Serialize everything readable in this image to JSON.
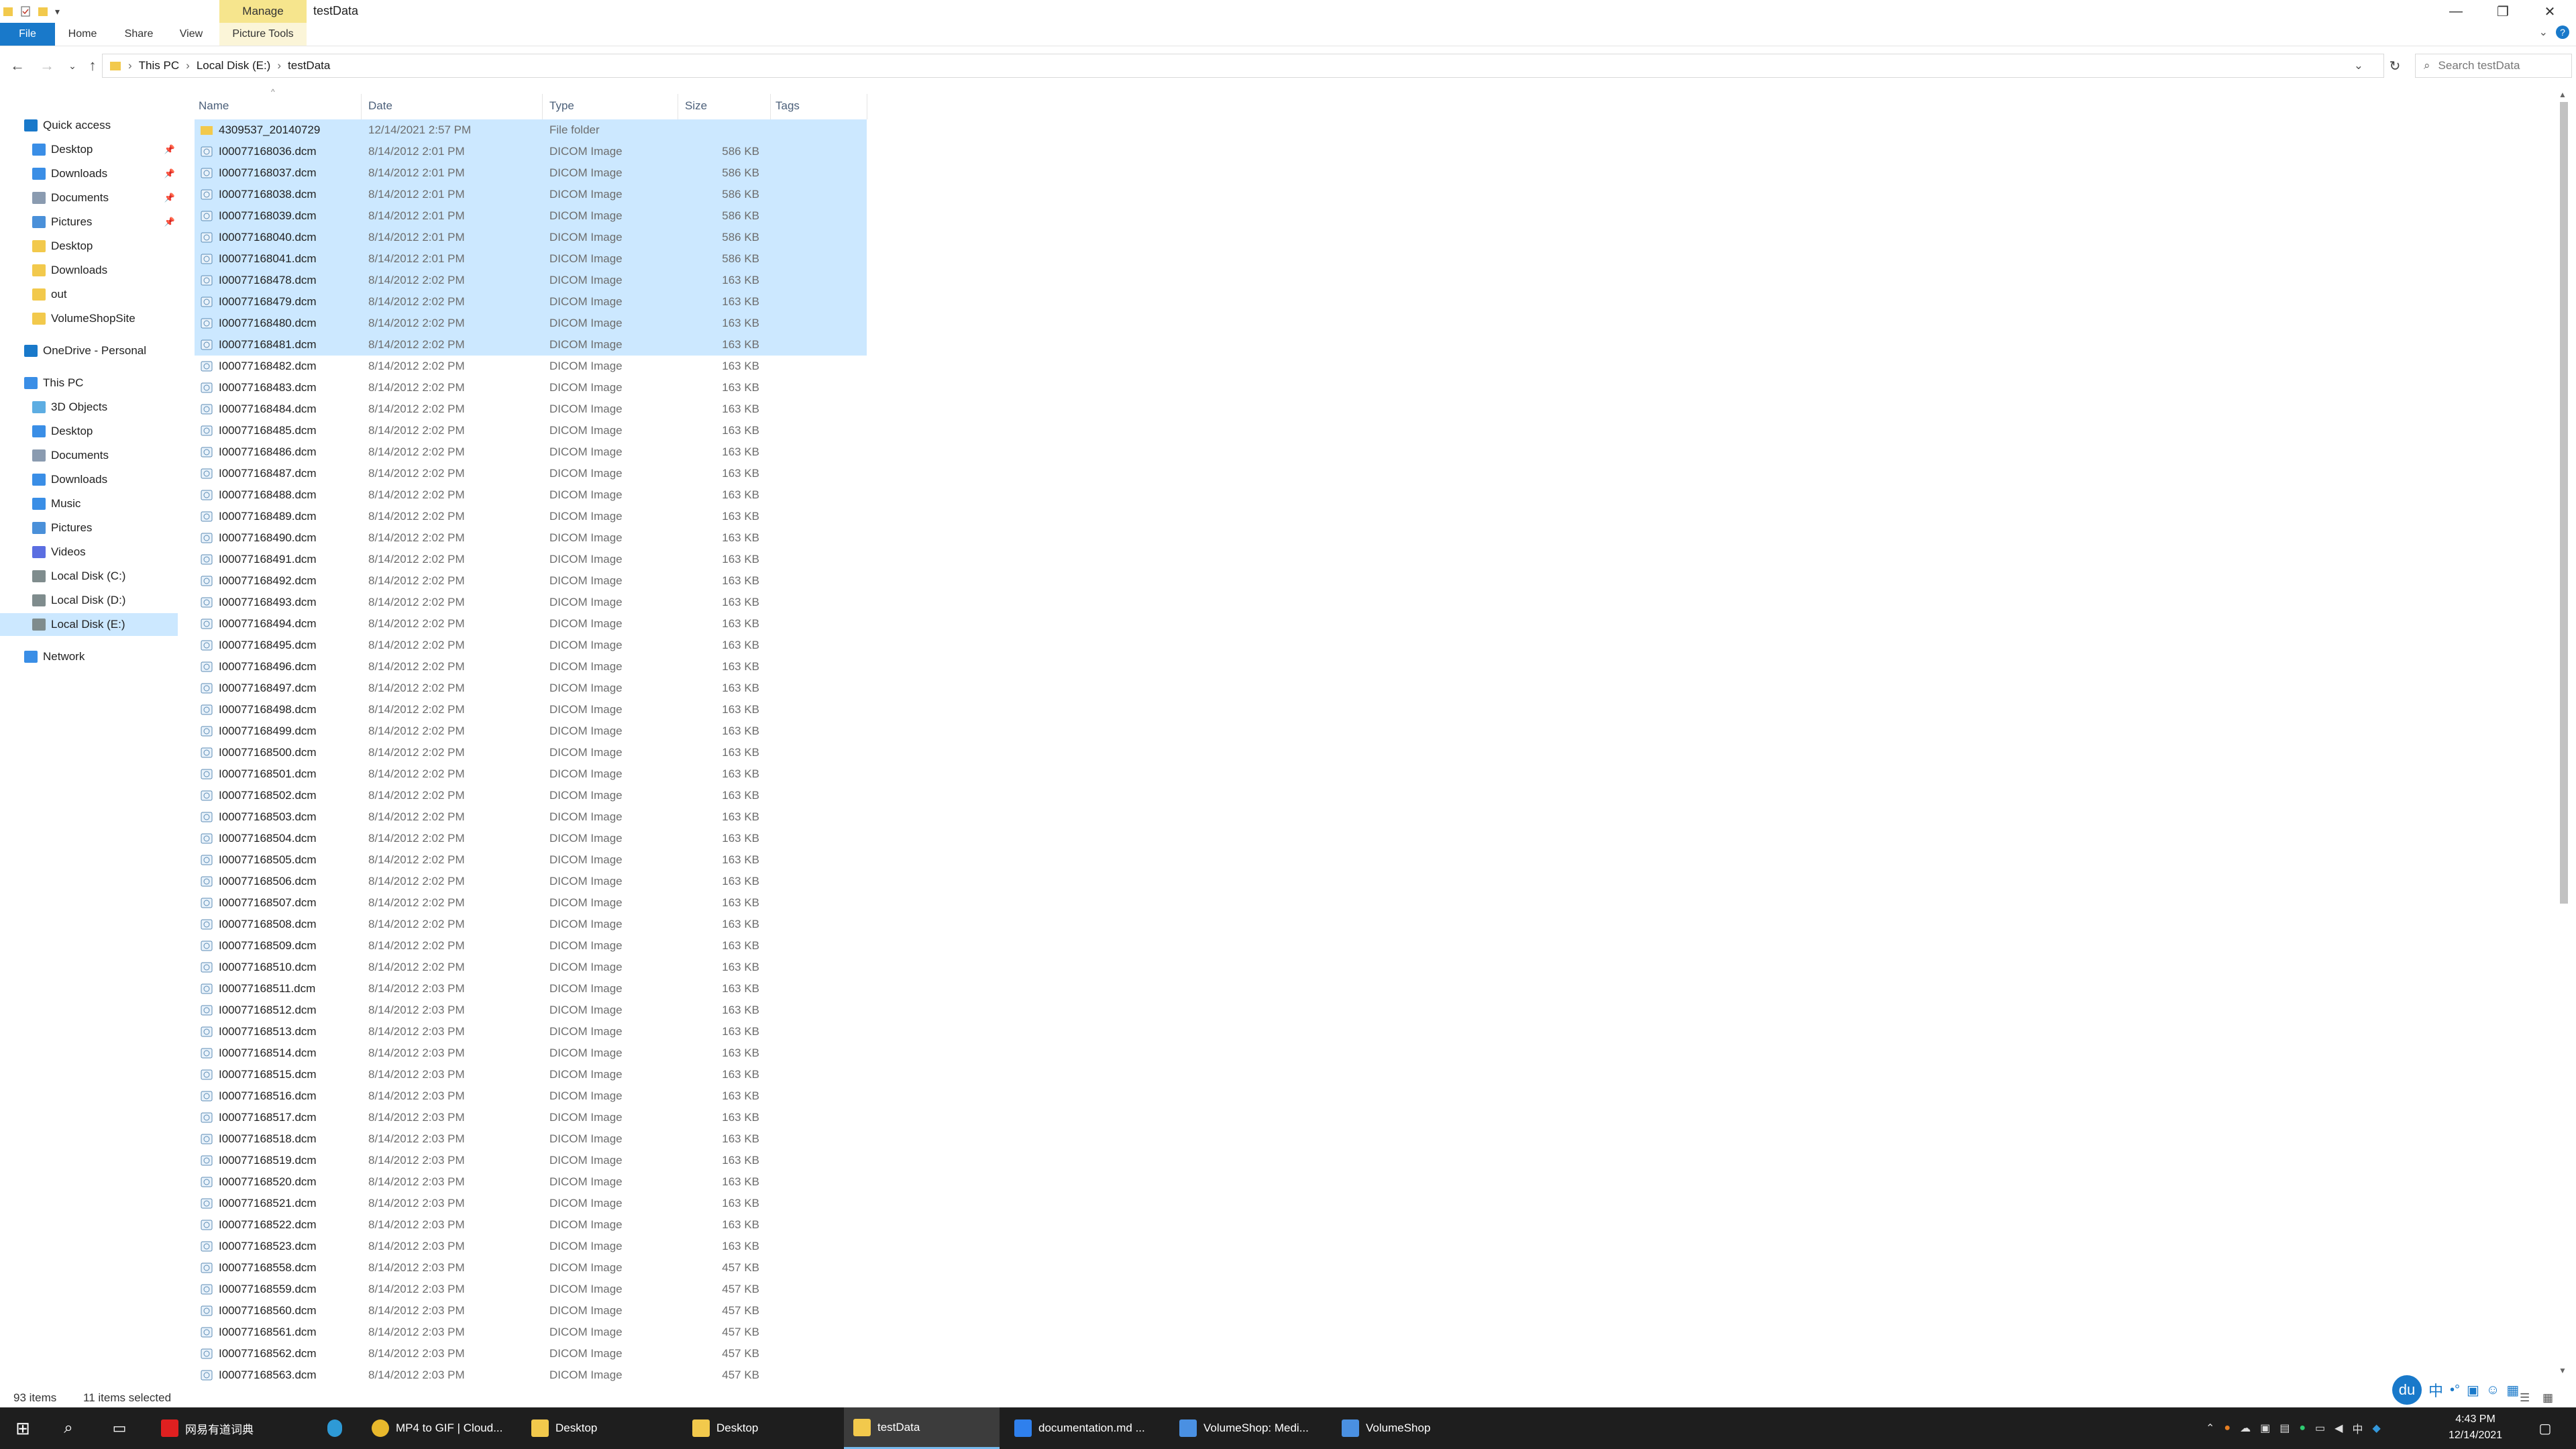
{
  "window": {
    "title": "testData",
    "contextual_tab": "Manage",
    "minimize": "—",
    "maximize": "❐",
    "close": "✕"
  },
  "ribbon": {
    "tabs": [
      "File",
      "Home",
      "Share",
      "View",
      "Picture Tools"
    ],
    "file_color": "#1979ca"
  },
  "address": {
    "crumbs": [
      "This PC",
      "Local Disk (E:)",
      "testData"
    ],
    "search_placeholder": "Search testData"
  },
  "navpane": {
    "items": [
      {
        "label": "Quick access",
        "icon": "star-icon",
        "pinned": false
      },
      {
        "label": "Desktop",
        "icon": "desktop-icon",
        "pinned": true
      },
      {
        "label": "Downloads",
        "icon": "download-icon",
        "pinned": true
      },
      {
        "label": "Documents",
        "icon": "document-icon",
        "pinned": true
      },
      {
        "label": "Pictures",
        "icon": "pictures-icon",
        "pinned": true
      },
      {
        "label": "Desktop",
        "icon": "folder-icon",
        "pinned": false
      },
      {
        "label": "Downloads",
        "icon": "folder-icon",
        "pinned": false
      },
      {
        "label": "out",
        "icon": "folder-icon",
        "pinned": false
      },
      {
        "label": "VolumeShopSite",
        "icon": "folder-icon",
        "pinned": false
      },
      {
        "label": "OneDrive - Personal",
        "icon": "cloud-icon",
        "pinned": false
      },
      {
        "label": "This PC",
        "icon": "computer-icon",
        "pinned": false
      },
      {
        "label": "3D Objects",
        "icon": "cube-icon",
        "pinned": false
      },
      {
        "label": "Desktop",
        "icon": "desktop-icon",
        "pinned": false
      },
      {
        "label": "Documents",
        "icon": "document-icon",
        "pinned": false
      },
      {
        "label": "Downloads",
        "icon": "download-icon",
        "pinned": false
      },
      {
        "label": "Music",
        "icon": "music-icon",
        "pinned": false
      },
      {
        "label": "Pictures",
        "icon": "pictures-icon",
        "pinned": false
      },
      {
        "label": "Videos",
        "icon": "video-icon",
        "pinned": false
      },
      {
        "label": "Local Disk (C:)",
        "icon": "drive-icon",
        "pinned": false
      },
      {
        "label": "Local Disk (D:)",
        "icon": "drive-icon",
        "pinned": false
      },
      {
        "label": "Local Disk (E:)",
        "icon": "drive-icon",
        "pinned": false
      },
      {
        "label": "Network",
        "icon": "network-icon",
        "pinned": false
      }
    ],
    "selected": "Local Disk (E:)"
  },
  "columns": [
    "Name",
    "Date",
    "Type",
    "Size",
    "Tags"
  ],
  "files": [
    {
      "name": "4309537_20140729",
      "date": "12/14/2021 2:57 PM",
      "type": "File folder",
      "size": "",
      "selected": true,
      "folder": true
    },
    {
      "name": "I00077168036.dcm",
      "date": "8/14/2012 2:01 PM",
      "type": "DICOM Image",
      "size": "586 KB",
      "selected": true
    },
    {
      "name": "I00077168037.dcm",
      "date": "8/14/2012 2:01 PM",
      "type": "DICOM Image",
      "size": "586 KB",
      "selected": true
    },
    {
      "name": "I00077168038.dcm",
      "date": "8/14/2012 2:01 PM",
      "type": "DICOM Image",
      "size": "586 KB",
      "selected": true
    },
    {
      "name": "I00077168039.dcm",
      "date": "8/14/2012 2:01 PM",
      "type": "DICOM Image",
      "size": "586 KB",
      "selected": true
    },
    {
      "name": "I00077168040.dcm",
      "date": "8/14/2012 2:01 PM",
      "type": "DICOM Image",
      "size": "586 KB",
      "selected": true
    },
    {
      "name": "I00077168041.dcm",
      "date": "8/14/2012 2:01 PM",
      "type": "DICOM Image",
      "size": "586 KB",
      "selected": true
    },
    {
      "name": "I00077168478.dcm",
      "date": "8/14/2012 2:02 PM",
      "type": "DICOM Image",
      "size": "163 KB",
      "selected": true
    },
    {
      "name": "I00077168479.dcm",
      "date": "8/14/2012 2:02 PM",
      "type": "DICOM Image",
      "size": "163 KB",
      "selected": true
    },
    {
      "name": "I00077168480.dcm",
      "date": "8/14/2012 2:02 PM",
      "type": "DICOM Image",
      "size": "163 KB",
      "selected": true
    },
    {
      "name": "I00077168481.dcm",
      "date": "8/14/2012 2:02 PM",
      "type": "DICOM Image",
      "size": "163 KB",
      "selected": true
    },
    {
      "name": "I00077168482.dcm",
      "date": "8/14/2012 2:02 PM",
      "type": "DICOM Image",
      "size": "163 KB"
    },
    {
      "name": "I00077168483.dcm",
      "date": "8/14/2012 2:02 PM",
      "type": "DICOM Image",
      "size": "163 KB"
    },
    {
      "name": "I00077168484.dcm",
      "date": "8/14/2012 2:02 PM",
      "type": "DICOM Image",
      "size": "163 KB"
    },
    {
      "name": "I00077168485.dcm",
      "date": "8/14/2012 2:02 PM",
      "type": "DICOM Image",
      "size": "163 KB"
    },
    {
      "name": "I00077168486.dcm",
      "date": "8/14/2012 2:02 PM",
      "type": "DICOM Image",
      "size": "163 KB"
    },
    {
      "name": "I00077168487.dcm",
      "date": "8/14/2012 2:02 PM",
      "type": "DICOM Image",
      "size": "163 KB"
    },
    {
      "name": "I00077168488.dcm",
      "date": "8/14/2012 2:02 PM",
      "type": "DICOM Image",
      "size": "163 KB"
    },
    {
      "name": "I00077168489.dcm",
      "date": "8/14/2012 2:02 PM",
      "type": "DICOM Image",
      "size": "163 KB"
    },
    {
      "name": "I00077168490.dcm",
      "date": "8/14/2012 2:02 PM",
      "type": "DICOM Image",
      "size": "163 KB"
    },
    {
      "name": "I00077168491.dcm",
      "date": "8/14/2012 2:02 PM",
      "type": "DICOM Image",
      "size": "163 KB"
    },
    {
      "name": "I00077168492.dcm",
      "date": "8/14/2012 2:02 PM",
      "type": "DICOM Image",
      "size": "163 KB"
    },
    {
      "name": "I00077168493.dcm",
      "date": "8/14/2012 2:02 PM",
      "type": "DICOM Image",
      "size": "163 KB"
    },
    {
      "name": "I00077168494.dcm",
      "date": "8/14/2012 2:02 PM",
      "type": "DICOM Image",
      "size": "163 KB"
    },
    {
      "name": "I00077168495.dcm",
      "date": "8/14/2012 2:02 PM",
      "type": "DICOM Image",
      "size": "163 KB"
    },
    {
      "name": "I00077168496.dcm",
      "date": "8/14/2012 2:02 PM",
      "type": "DICOM Image",
      "size": "163 KB"
    },
    {
      "name": "I00077168497.dcm",
      "date": "8/14/2012 2:02 PM",
      "type": "DICOM Image",
      "size": "163 KB"
    },
    {
      "name": "I00077168498.dcm",
      "date": "8/14/2012 2:02 PM",
      "type": "DICOM Image",
      "size": "163 KB"
    },
    {
      "name": "I00077168499.dcm",
      "date": "8/14/2012 2:02 PM",
      "type": "DICOM Image",
      "size": "163 KB"
    },
    {
      "name": "I00077168500.dcm",
      "date": "8/14/2012 2:02 PM",
      "type": "DICOM Image",
      "size": "163 KB"
    },
    {
      "name": "I00077168501.dcm",
      "date": "8/14/2012 2:02 PM",
      "type": "DICOM Image",
      "size": "163 KB"
    },
    {
      "name": "I00077168502.dcm",
      "date": "8/14/2012 2:02 PM",
      "type": "DICOM Image",
      "size": "163 KB"
    },
    {
      "name": "I00077168503.dcm",
      "date": "8/14/2012 2:02 PM",
      "type": "DICOM Image",
      "size": "163 KB"
    },
    {
      "name": "I00077168504.dcm",
      "date": "8/14/2012 2:02 PM",
      "type": "DICOM Image",
      "size": "163 KB"
    },
    {
      "name": "I00077168505.dcm",
      "date": "8/14/2012 2:02 PM",
      "type": "DICOM Image",
      "size": "163 KB"
    },
    {
      "name": "I00077168506.dcm",
      "date": "8/14/2012 2:02 PM",
      "type": "DICOM Image",
      "size": "163 KB"
    },
    {
      "name": "I00077168507.dcm",
      "date": "8/14/2012 2:02 PM",
      "type": "DICOM Image",
      "size": "163 KB"
    },
    {
      "name": "I00077168508.dcm",
      "date": "8/14/2012 2:02 PM",
      "type": "DICOM Image",
      "size": "163 KB"
    },
    {
      "name": "I00077168509.dcm",
      "date": "8/14/2012 2:02 PM",
      "type": "DICOM Image",
      "size": "163 KB"
    },
    {
      "name": "I00077168510.dcm",
      "date": "8/14/2012 2:02 PM",
      "type": "DICOM Image",
      "size": "163 KB"
    },
    {
      "name": "I00077168511.dcm",
      "date": "8/14/2012 2:03 PM",
      "type": "DICOM Image",
      "size": "163 KB"
    },
    {
      "name": "I00077168512.dcm",
      "date": "8/14/2012 2:03 PM",
      "type": "DICOM Image",
      "size": "163 KB"
    },
    {
      "name": "I00077168513.dcm",
      "date": "8/14/2012 2:03 PM",
      "type": "DICOM Image",
      "size": "163 KB"
    },
    {
      "name": "I00077168514.dcm",
      "date": "8/14/2012 2:03 PM",
      "type": "DICOM Image",
      "size": "163 KB"
    },
    {
      "name": "I00077168515.dcm",
      "date": "8/14/2012 2:03 PM",
      "type": "DICOM Image",
      "size": "163 KB"
    },
    {
      "name": "I00077168516.dcm",
      "date": "8/14/2012 2:03 PM",
      "type": "DICOM Image",
      "size": "163 KB"
    },
    {
      "name": "I00077168517.dcm",
      "date": "8/14/2012 2:03 PM",
      "type": "DICOM Image",
      "size": "163 KB"
    },
    {
      "name": "I00077168518.dcm",
      "date": "8/14/2012 2:03 PM",
      "type": "DICOM Image",
      "size": "163 KB"
    },
    {
      "name": "I00077168519.dcm",
      "date": "8/14/2012 2:03 PM",
      "type": "DICOM Image",
      "size": "163 KB"
    },
    {
      "name": "I00077168520.dcm",
      "date": "8/14/2012 2:03 PM",
      "type": "DICOM Image",
      "size": "163 KB"
    },
    {
      "name": "I00077168521.dcm",
      "date": "8/14/2012 2:03 PM",
      "type": "DICOM Image",
      "size": "163 KB"
    },
    {
      "name": "I00077168522.dcm",
      "date": "8/14/2012 2:03 PM",
      "type": "DICOM Image",
      "size": "163 KB"
    },
    {
      "name": "I00077168523.dcm",
      "date": "8/14/2012 2:03 PM",
      "type": "DICOM Image",
      "size": "163 KB"
    },
    {
      "name": "I00077168558.dcm",
      "date": "8/14/2012 2:03 PM",
      "type": "DICOM Image",
      "size": "457 KB"
    },
    {
      "name": "I00077168559.dcm",
      "date": "8/14/2012 2:03 PM",
      "type": "DICOM Image",
      "size": "457 KB"
    },
    {
      "name": "I00077168560.dcm",
      "date": "8/14/2012 2:03 PM",
      "type": "DICOM Image",
      "size": "457 KB"
    },
    {
      "name": "I00077168561.dcm",
      "date": "8/14/2012 2:03 PM",
      "type": "DICOM Image",
      "size": "457 KB"
    },
    {
      "name": "I00077168562.dcm",
      "date": "8/14/2012 2:03 PM",
      "type": "DICOM Image",
      "size": "457 KB"
    },
    {
      "name": "I00077168563.dcm",
      "date": "8/14/2012 2:03 PM",
      "type": "DICOM Image",
      "size": "457 KB"
    }
  ],
  "status": {
    "items_count": "93 items",
    "selected_count": "11 items selected"
  },
  "taskbar": {
    "apps": [
      {
        "label": "网易有道词典",
        "icon": "youdao-icon",
        "active": false
      },
      {
        "label": "",
        "icon": "edge-icon",
        "active": false
      },
      {
        "label": "MP4 to GIF | Cloud...",
        "icon": "chrome-icon",
        "active": false
      },
      {
        "label": "Desktop",
        "icon": "folder-icon",
        "active": false
      },
      {
        "label": "Desktop",
        "icon": "folder-icon",
        "active": false
      },
      {
        "label": "testData",
        "icon": "folder-icon",
        "active": true
      },
      {
        "label": "documentation.md ...",
        "icon": "vscode-icon",
        "active": false
      },
      {
        "label": "VolumeShop: Medi...",
        "icon": "volumeshop-icon",
        "active": false
      },
      {
        "label": "VolumeShop",
        "icon": "volumeshop-icon",
        "active": false
      }
    ],
    "time": "4:43 PM",
    "date": "12/14/2021",
    "ime_label": "中"
  }
}
